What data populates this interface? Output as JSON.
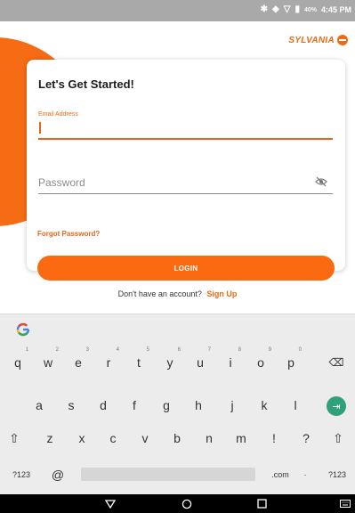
{
  "status_bar": {
    "bluetooth_icon": "bluetooth-icon",
    "vibrate_icon": "vibrate-icon",
    "wifi_icon": "wifi-icon",
    "battery_icon": "battery-icon",
    "battery": "40%",
    "time": "4:45 PM"
  },
  "brand": {
    "name": "SYLVANIA"
  },
  "login_card": {
    "title": "Let's Get Started!",
    "email_label": "Email Address",
    "email_value": "",
    "password_placeholder": "Password",
    "password_toggle_icon": "eye-slash-icon",
    "forgot_password": "Forgot Password?",
    "login_button": "LOGIN"
  },
  "signup": {
    "prompt": "Don't have an account?",
    "link": "Sign Up"
  },
  "keyboard": {
    "google_icon": "google-g-icon",
    "row1": [
      {
        "key": "q",
        "hint": "1"
      },
      {
        "key": "w",
        "hint": "2"
      },
      {
        "key": "e",
        "hint": "3"
      },
      {
        "key": "r",
        "hint": "4"
      },
      {
        "key": "t",
        "hint": "5"
      },
      {
        "key": "y",
        "hint": "6"
      },
      {
        "key": "u",
        "hint": "7"
      },
      {
        "key": "i",
        "hint": "8"
      },
      {
        "key": "o",
        "hint": "9"
      },
      {
        "key": "p",
        "hint": "0"
      },
      {
        "key": "⌫",
        "hint": ""
      }
    ],
    "row2": [
      "a",
      "s",
      "d",
      "f",
      "g",
      "h",
      "j",
      "k",
      "l"
    ],
    "enter_icon": "enter-arrow-icon",
    "row3": [
      "⇧",
      "z",
      "x",
      "c",
      "v",
      "b",
      "n",
      "m",
      "!",
      "?",
      "⇧"
    ],
    "row4": {
      "symbols_left": "?123",
      "at": "@",
      "dotcom": ".com",
      "dot": "·",
      "symbols_right": "?123"
    }
  },
  "nav_bar": {
    "back_icon": "back-triangle-icon",
    "home_icon": "home-circle-icon",
    "recents_icon": "recents-square-icon",
    "keyboard_icon": "keyboard-icon"
  }
}
